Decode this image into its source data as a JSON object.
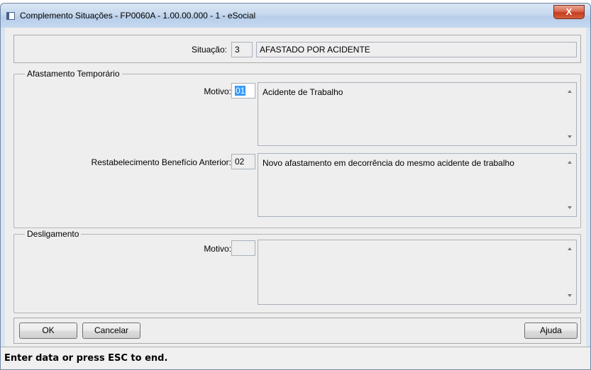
{
  "window": {
    "title": "Complemento Situações - FP0060A - 1.00.00.000 - 1 - eSocial",
    "close_label": "X"
  },
  "situacao": {
    "label": "Situação:",
    "code": "3",
    "description": "AFASTADO POR ACIDENTE"
  },
  "afastamento": {
    "legend": "Afastamento Temporário",
    "motivo_label": "Motivo:",
    "motivo_code": "01",
    "motivo_text": "Acidente de Trabalho",
    "restab_label": "Restabelecimento Benefício Anterior:",
    "restab_code": "02",
    "restab_text": "Novo afastamento em decorrência do mesmo acidente de trabalho"
  },
  "desligamento": {
    "legend": "Desligamento",
    "motivo_label": "Motivo:",
    "motivo_code": "",
    "motivo_text": ""
  },
  "buttons": {
    "ok": "OK",
    "cancel": "Cancelar",
    "help": "Ajuda"
  },
  "status": {
    "text": "Enter data or press ESC to end."
  }
}
